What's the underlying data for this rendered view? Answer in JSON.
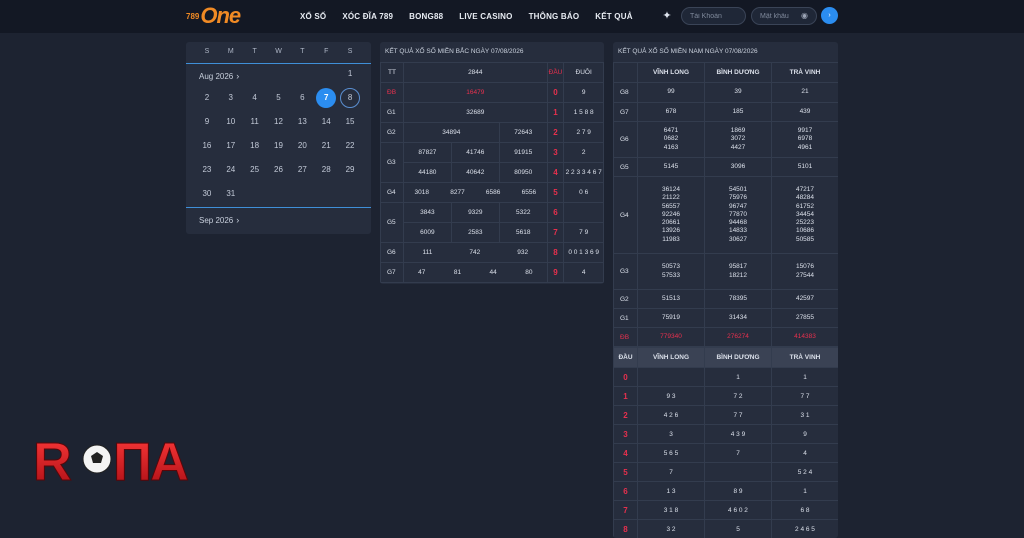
{
  "header": {
    "logo": {
      "small": "789",
      "big": "One"
    },
    "nav": [
      "XỔ SỐ",
      "XÓC ĐĨA 789",
      "BONG88",
      "LIVE CASINO",
      "THÔNG BÁO",
      "KẾT QUẢ"
    ],
    "username_placeholder": "Tài Khoản",
    "password_placeholder": "Mật khẩu",
    "login_label": "›",
    "star_icon": "star-icon",
    "eye_icon": "eye-icon"
  },
  "calendar": {
    "dow": [
      "S",
      "M",
      "T",
      "W",
      "T",
      "F",
      "S"
    ],
    "month": "Aug 2026",
    "next_month": "Sep 2026",
    "first_row_blanks": 6,
    "days": [
      "1",
      "2",
      "3",
      "4",
      "5",
      "6",
      "7",
      "8",
      "9",
      "10",
      "11",
      "12",
      "13",
      "14",
      "15",
      "16",
      "17",
      "18",
      "19",
      "20",
      "21",
      "22",
      "23",
      "24",
      "25",
      "26",
      "27",
      "28",
      "29",
      "30",
      "31"
    ],
    "selected": "7",
    "highlight": "8",
    "accent": "#2b8df0"
  },
  "north": {
    "title": "KẾT QUẢ XỔ SỐ MIỀN BẮC NGÀY 07/08/2026",
    "headers": {
      "tt": "TT",
      "code": "2844",
      "dau": "ĐẦU",
      "duoi": "ĐUÔI"
    },
    "rows": [
      {
        "label": "ĐB",
        "vals": [
          "16479"
        ],
        "dau": "0",
        "duoi": "9",
        "red": true
      },
      {
        "label": "G1",
        "vals": [
          "32689"
        ],
        "dau": "1",
        "duoi": "1 5 8 8"
      },
      {
        "label": "G2",
        "vals": [
          "34894",
          "72643"
        ],
        "dau": "2",
        "duoi": "2 7 9"
      },
      {
        "label": "G3",
        "vals": [
          "87827",
          "41746",
          "91915",
          "44180",
          "40642",
          "80950"
        ],
        "dau": [
          "3",
          "4"
        ],
        "duoi": [
          "2",
          "2 2 3 3 4 6 7"
        ]
      },
      {
        "label": "G4",
        "vals": [
          "3018",
          "8277",
          "6586",
          "6556"
        ],
        "dau": "5",
        "duoi": "0 6"
      },
      {
        "label": "G5",
        "vals": [
          "3843",
          "9329",
          "5322",
          "6009",
          "2583",
          "5618"
        ],
        "dau": [
          "6",
          "7"
        ],
        "duoi": [
          "",
          "7 9"
        ]
      },
      {
        "label": "G6",
        "vals": [
          "111",
          "742",
          "932"
        ],
        "dau": "8",
        "duoi": "0 0 1 3 6 9"
      },
      {
        "label": "G7",
        "vals": [
          "47",
          "81",
          "44",
          "80"
        ],
        "dau": "9",
        "duoi": "4"
      }
    ]
  },
  "south": {
    "title": "KẾT QUẢ XỔ SỐ MIỀN NAM NGÀY 07/08/2026",
    "provinces": [
      "VĨNH LONG",
      "BÌNH DƯƠNG",
      "TRÀ VINH"
    ],
    "prizes": [
      {
        "label": "G8",
        "vals": [
          [
            "99"
          ],
          [
            "39"
          ],
          [
            "21"
          ]
        ]
      },
      {
        "label": "G7",
        "vals": [
          [
            "678"
          ],
          [
            "185"
          ],
          [
            "439"
          ]
        ]
      },
      {
        "label": "G6",
        "vals": [
          [
            "6471",
            "0682",
            "4163"
          ],
          [
            "1869",
            "3072",
            "4427"
          ],
          [
            "9917",
            "6978",
            "4961"
          ]
        ]
      },
      {
        "label": "G5",
        "vals": [
          [
            "5145"
          ],
          [
            "3096"
          ],
          [
            "5101"
          ]
        ]
      },
      {
        "label": "G4",
        "vals": [
          [
            "36124",
            "21122",
            "56557",
            "92246",
            "20661",
            "13926",
            "11983"
          ],
          [
            "54501",
            "75976",
            "96747",
            "77870",
            "94468",
            "14833",
            "30627"
          ],
          [
            "47217",
            "48284",
            "61752",
            "34454",
            "25223",
            "10686",
            "50585"
          ]
        ]
      },
      {
        "label": "G3",
        "vals": [
          [
            "50573",
            "57533"
          ],
          [
            "95817",
            "18212"
          ],
          [
            "15076",
            "27544"
          ]
        ]
      },
      {
        "label": "G2",
        "vals": [
          [
            "51513"
          ],
          [
            "78395"
          ],
          [
            "42597"
          ]
        ]
      },
      {
        "label": "G1",
        "vals": [
          [
            "75919"
          ],
          [
            "31434"
          ],
          [
            "27855"
          ]
        ]
      },
      {
        "label": "ĐB",
        "vals": [
          [
            "779340"
          ],
          [
            "276274"
          ],
          [
            "414383"
          ]
        ],
        "red": true
      }
    ],
    "loto_header": {
      "dau": "ĐẦU",
      "cols": [
        "VĨNH LONG",
        "BÌNH DƯƠNG",
        "TRÀ VINH"
      ]
    },
    "loto": [
      {
        "dau": "0",
        "vals": [
          "",
          "1",
          "1"
        ]
      },
      {
        "dau": "1",
        "vals": [
          "9 3",
          "7 2",
          "7 7"
        ]
      },
      {
        "dau": "2",
        "vals": [
          "4 2 6",
          "7 7",
          "3 1"
        ]
      },
      {
        "dau": "3",
        "vals": [
          "3",
          "4 3 9",
          "9"
        ]
      },
      {
        "dau": "4",
        "vals": [
          "5 6 5",
          "7",
          "4"
        ]
      },
      {
        "dau": "5",
        "vals": [
          "7",
          "",
          "5 2 4"
        ]
      },
      {
        "dau": "6",
        "vals": [
          "1 3",
          "8 9",
          "1"
        ]
      },
      {
        "dau": "7",
        "vals": [
          "3 1 8",
          "4 6 0 2",
          "6 8"
        ]
      },
      {
        "dau": "8",
        "vals": [
          "3 2",
          "5",
          "2 4 6 5"
        ]
      }
    ]
  },
  "watermark": "ROMA"
}
